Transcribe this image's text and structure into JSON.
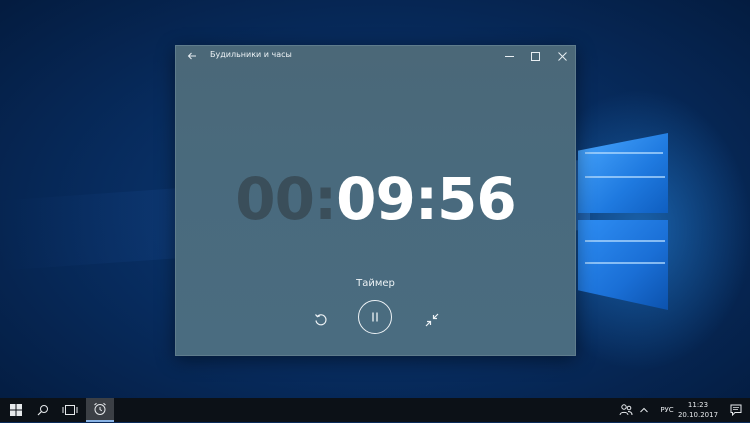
{
  "window": {
    "title": "Будильники и часы",
    "back_icon": "back-arrow-icon",
    "controls": [
      "minimize-icon",
      "maximize-icon",
      "close-icon"
    ]
  },
  "timer": {
    "hours": "00",
    "separator": ":",
    "time": "09:56",
    "label": "Таймер"
  },
  "controls": {
    "reset_icon": "reset-icon",
    "pause_icon": "pause-icon",
    "compact_icon": "compact-overlay-icon"
  },
  "taskbar": {
    "language": "РУС",
    "time": "11:23",
    "date": "20.10.2017",
    "pinned": [
      "start-icon",
      "search-icon",
      "task-view-icon",
      "alarms-clock-icon"
    ]
  },
  "colors": {
    "window_bg": "#4b6878",
    "timer_dim": "#3a4e5a",
    "timer_bright": "#ffffff",
    "taskbar_bg": "#0c1117"
  }
}
